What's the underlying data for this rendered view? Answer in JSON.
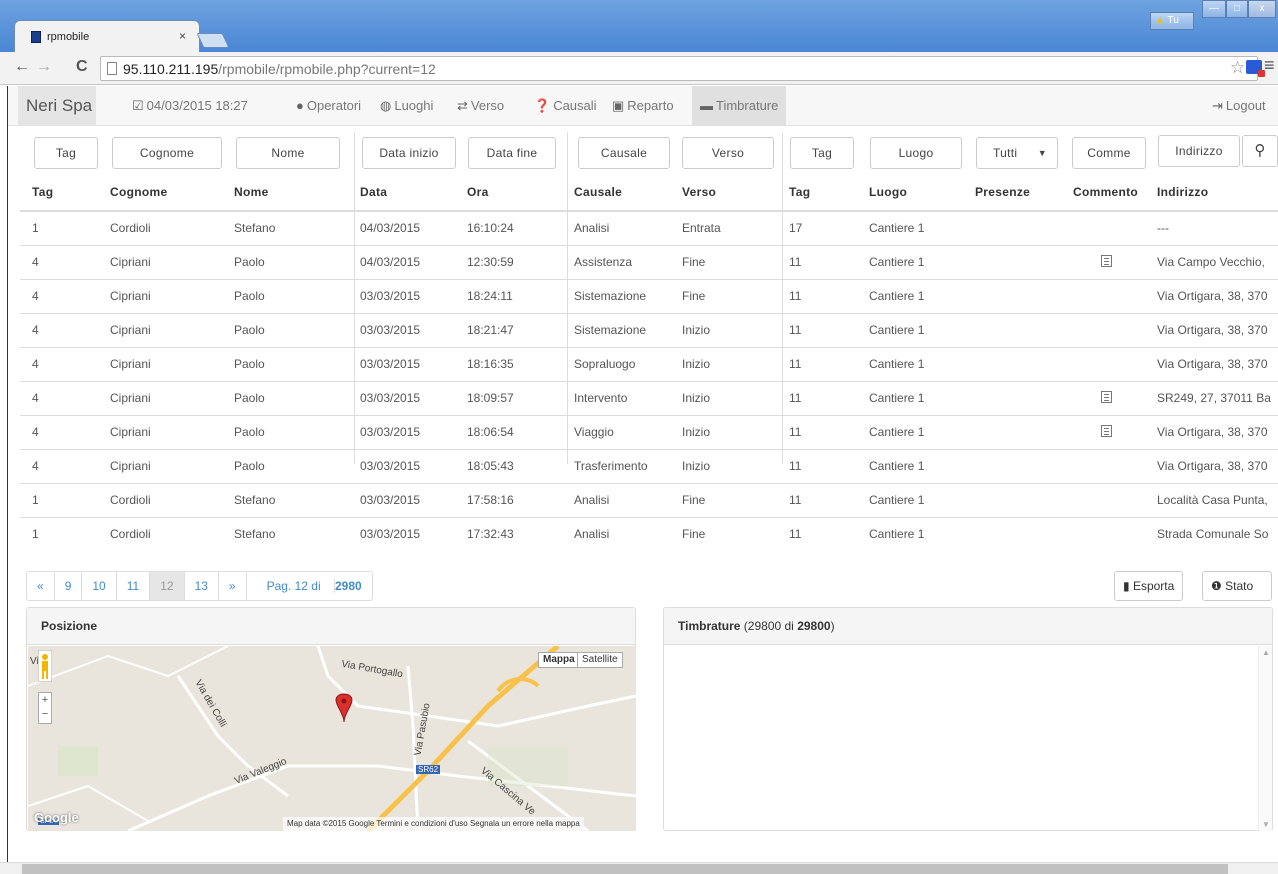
{
  "browser": {
    "tab_title": "rpmobile",
    "tab_close": "×",
    "url_host": "95.110.211.195",
    "url_path": "/rpmobile/rpmobile.php?current=12",
    "warn_label": "Tu",
    "win_min": "—",
    "win_max": "□",
    "win_close": "x"
  },
  "navbar": {
    "brand": "Neri Spa",
    "datetime": "04/03/2015 18:27",
    "items": [
      "Operatori",
      "Luoghi",
      "Verso",
      "Causali",
      "Reparto",
      "Timbrature"
    ],
    "logout": "Logout"
  },
  "filters": {
    "tag": "Tag",
    "cognome": "Cognome",
    "nome": "Nome",
    "data_inizio": "Data inizio",
    "data_fine": "Data fine",
    "causale": "Causale",
    "verso": "Verso",
    "tag2": "Tag",
    "luogo": "Luogo",
    "presenze": "Tutti",
    "commento": "Comme",
    "indirizzo": "Indirizzo"
  },
  "table": {
    "headers": [
      "Tag",
      "Cognome",
      "Nome",
      "Data",
      "Ora",
      "Causale",
      "Verso",
      "Tag",
      "Luogo",
      "Presenze",
      "Commento",
      "Indirizzo"
    ],
    "rows": [
      {
        "tag": "1",
        "cognome": "Cordioli",
        "nome": "Stefano",
        "data": "04/03/2015",
        "ora": "16:10:24",
        "causale": "Analisi",
        "verso": "Entrata",
        "tag2": "17",
        "luogo": "Cantiere 1",
        "presenze": "",
        "commento": false,
        "indirizzo": "---"
      },
      {
        "tag": "4",
        "cognome": "Cipriani",
        "nome": "Paolo",
        "data": "04/03/2015",
        "ora": "12:30:59",
        "causale": "Assistenza",
        "verso": "Fine",
        "tag2": "11",
        "luogo": "Cantiere 1",
        "presenze": "",
        "commento": true,
        "indirizzo": "Via Campo Vecchio, "
      },
      {
        "tag": "4",
        "cognome": "Cipriani",
        "nome": "Paolo",
        "data": "03/03/2015",
        "ora": "18:24:11",
        "causale": "Sistemazione",
        "verso": "Fine",
        "tag2": "11",
        "luogo": "Cantiere 1",
        "presenze": "",
        "commento": false,
        "indirizzo": "Via Ortigara, 38, 370"
      },
      {
        "tag": "4",
        "cognome": "Cipriani",
        "nome": "Paolo",
        "data": "03/03/2015",
        "ora": "18:21:47",
        "causale": "Sistemazione",
        "verso": "Inizio",
        "tag2": "11",
        "luogo": "Cantiere 1",
        "presenze": "",
        "commento": false,
        "indirizzo": "Via Ortigara, 38, 370"
      },
      {
        "tag": "4",
        "cognome": "Cipriani",
        "nome": "Paolo",
        "data": "03/03/2015",
        "ora": "18:16:35",
        "causale": "Sopraluogo",
        "verso": "Inizio",
        "tag2": "11",
        "luogo": "Cantiere 1",
        "presenze": "",
        "commento": false,
        "indirizzo": "Via Ortigara, 38, 370"
      },
      {
        "tag": "4",
        "cognome": "Cipriani",
        "nome": "Paolo",
        "data": "03/03/2015",
        "ora": "18:09:57",
        "causale": "Intervento",
        "verso": "Inizio",
        "tag2": "11",
        "luogo": "Cantiere 1",
        "presenze": "",
        "commento": true,
        "indirizzo": "SR249, 27, 37011 Ba"
      },
      {
        "tag": "4",
        "cognome": "Cipriani",
        "nome": "Paolo",
        "data": "03/03/2015",
        "ora": "18:06:54",
        "causale": "Viaggio",
        "verso": "Inizio",
        "tag2": "11",
        "luogo": "Cantiere 1",
        "presenze": "",
        "commento": true,
        "indirizzo": "Via Ortigara, 38, 370"
      },
      {
        "tag": "4",
        "cognome": "Cipriani",
        "nome": "Paolo",
        "data": "03/03/2015",
        "ora": "18:05:43",
        "causale": "Trasferimento",
        "verso": "Inizio",
        "tag2": "11",
        "luogo": "Cantiere 1",
        "presenze": "",
        "commento": false,
        "indirizzo": "Via Ortigara, 38, 370"
      },
      {
        "tag": "1",
        "cognome": "Cordioli",
        "nome": "Stefano",
        "data": "03/03/2015",
        "ora": "17:58:16",
        "causale": "Analisi",
        "verso": "Fine",
        "tag2": "11",
        "luogo": "Cantiere 1",
        "presenze": "",
        "commento": false,
        "indirizzo": "Località Casa Punta,"
      },
      {
        "tag": "1",
        "cognome": "Cordioli",
        "nome": "Stefano",
        "data": "03/03/2015",
        "ora": "17:32:43",
        "causale": "Analisi",
        "verso": "Fine",
        "tag2": "11",
        "luogo": "Cantiere 1",
        "presenze": "",
        "commento": false,
        "indirizzo": "Strada Comunale So"
      }
    ]
  },
  "pager": {
    "prev": "«",
    "pages": [
      "9",
      "10",
      "11",
      "12",
      "13"
    ],
    "active": "12",
    "next": "»",
    "info_prefix": "Pag. 12 di ",
    "info_total": "2980"
  },
  "buttons": {
    "esporta": "Esporta",
    "stato": "Stato"
  },
  "posizione": {
    "title": "Posizione",
    "map_type_map": "Mappa",
    "map_type_sat": "Satellite",
    "labels": [
      "Via Portogallo",
      "Via dei Colli",
      "Via Valeggio",
      "Via Pasubio",
      "SR62",
      "Via Cascina Ve",
      "SP24",
      "Vi"
    ],
    "footer": "Map data ©2015 Google   Termini e condizioni d'uso   Segnala un errore nella mappa",
    "logo": "Google"
  },
  "timbrature": {
    "title": "Timbrature",
    "count_prefix": " (29800 di ",
    "count_total": "29800",
    "count_suffix": ")"
  },
  "colors": {
    "link": "#428bca",
    "marker": "#d9302c",
    "road": "#f8c14a"
  }
}
